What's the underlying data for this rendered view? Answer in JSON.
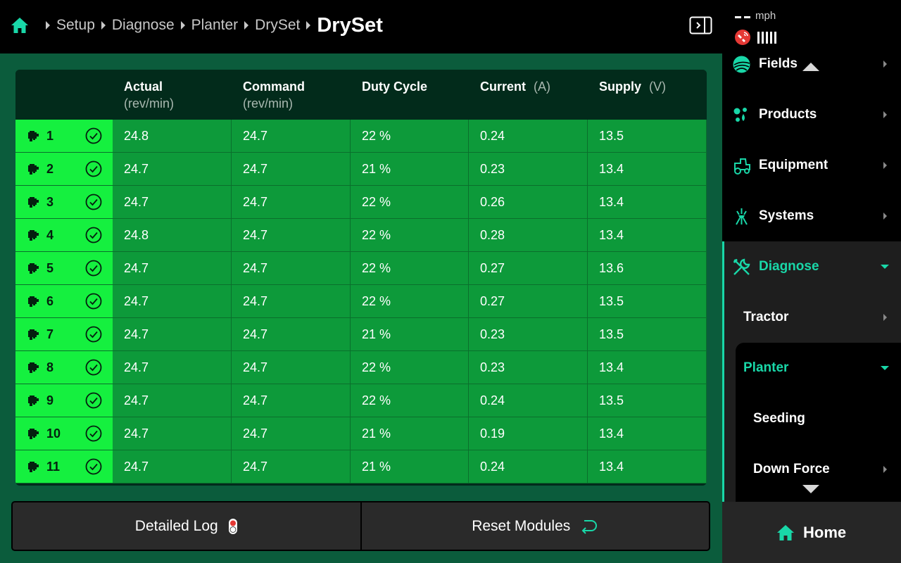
{
  "breadcrumb": {
    "items": [
      "Setup",
      "Diagnose",
      "Planter",
      "DrySet"
    ],
    "current": "DrySet"
  },
  "table": {
    "columns": [
      {
        "title": "Actual",
        "unit": "(rev/min)"
      },
      {
        "title": "Command",
        "unit": "(rev/min)"
      },
      {
        "title": "Duty Cycle",
        "unit": ""
      },
      {
        "title": "Current",
        "unit": "(A)"
      },
      {
        "title": "Supply",
        "unit": "(V)"
      }
    ],
    "rows": [
      {
        "num": "1",
        "actual": "24.8",
        "command": "24.7",
        "duty": "22 %",
        "current": "0.24",
        "supply": "13.5"
      },
      {
        "num": "2",
        "actual": "24.7",
        "command": "24.7",
        "duty": "21 %",
        "current": "0.23",
        "supply": "13.4"
      },
      {
        "num": "3",
        "actual": "24.7",
        "command": "24.7",
        "duty": "22 %",
        "current": "0.26",
        "supply": "13.4"
      },
      {
        "num": "4",
        "actual": "24.8",
        "command": "24.7",
        "duty": "22 %",
        "current": "0.28",
        "supply": "13.4"
      },
      {
        "num": "5",
        "actual": "24.7",
        "command": "24.7",
        "duty": "22 %",
        "current": "0.27",
        "supply": "13.6"
      },
      {
        "num": "6",
        "actual": "24.7",
        "command": "24.7",
        "duty": "22 %",
        "current": "0.27",
        "supply": "13.5"
      },
      {
        "num": "7",
        "actual": "24.7",
        "command": "24.7",
        "duty": "21 %",
        "current": "0.23",
        "supply": "13.5"
      },
      {
        "num": "8",
        "actual": "24.7",
        "command": "24.7",
        "duty": "22 %",
        "current": "0.23",
        "supply": "13.4"
      },
      {
        "num": "9",
        "actual": "24.7",
        "command": "24.7",
        "duty": "22 %",
        "current": "0.24",
        "supply": "13.5"
      },
      {
        "num": "10",
        "actual": "24.7",
        "command": "24.7",
        "duty": "21 %",
        "current": "0.19",
        "supply": "13.4"
      },
      {
        "num": "11",
        "actual": "24.7",
        "command": "24.7",
        "duty": "21 %",
        "current": "0.24",
        "supply": "13.4"
      }
    ]
  },
  "buttons": {
    "detailed_log": "Detailed Log",
    "reset_modules": "Reset Modules"
  },
  "status": {
    "speed_value": "--",
    "speed_unit": "mph"
  },
  "sidebar": {
    "items": [
      {
        "label": "Fields",
        "icon": "fields-icon"
      },
      {
        "label": "Products",
        "icon": "products-icon"
      },
      {
        "label": "Equipment",
        "icon": "tractor-icon"
      },
      {
        "label": "Systems",
        "icon": "systems-icon"
      },
      {
        "label": "Diagnose",
        "icon": "wrench-icon"
      }
    ],
    "sub_items": {
      "tractor": "Tractor",
      "planter": "Planter",
      "seeding": "Seeding",
      "down_force": "Down Force"
    },
    "home": "Home"
  },
  "colors": {
    "accent": "#19d7a8",
    "row_status": "#15f03f",
    "cell_bg": "#0d9a3a",
    "main_bg": "#0b5c3c"
  }
}
